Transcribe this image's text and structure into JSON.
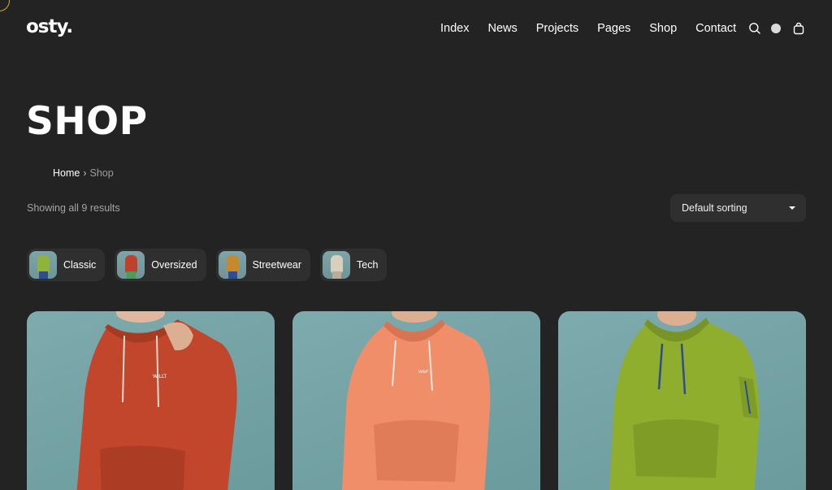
{
  "header": {
    "logo": "osty.",
    "nav": [
      "Index",
      "News",
      "Projects",
      "Pages",
      "Shop",
      "Contact"
    ],
    "icons": [
      "search-icon",
      "theme-toggle-icon",
      "shopping-bag-icon"
    ]
  },
  "page": {
    "title": "SHOP",
    "breadcrumb": {
      "home": "Home",
      "separator": "›",
      "current": "Shop"
    },
    "result_count": "Showing all 9 results",
    "sorting": {
      "selected": "Default sorting"
    }
  },
  "categories": [
    {
      "label": "Classic",
      "color": "#8fb43a"
    },
    {
      "label": "Oversized",
      "color": "#c0412b"
    },
    {
      "label": "Streetwear",
      "color": "#c6892e"
    },
    {
      "label": "Tech",
      "color": "#d9cfbd"
    }
  ],
  "products": [
    {
      "name": "red-hoodie",
      "color": "#c1462b",
      "print": "WILLT"
    },
    {
      "name": "coral-hoodie",
      "color": "#ef8e68",
      "print": "W&P"
    },
    {
      "name": "green-hoodie",
      "color": "#8fae2e",
      "print": ""
    }
  ],
  "colors": {
    "background": "#232323",
    "surface": "#2f2f2f",
    "text": "#ffffff",
    "muted": "#a5a5a5"
  }
}
